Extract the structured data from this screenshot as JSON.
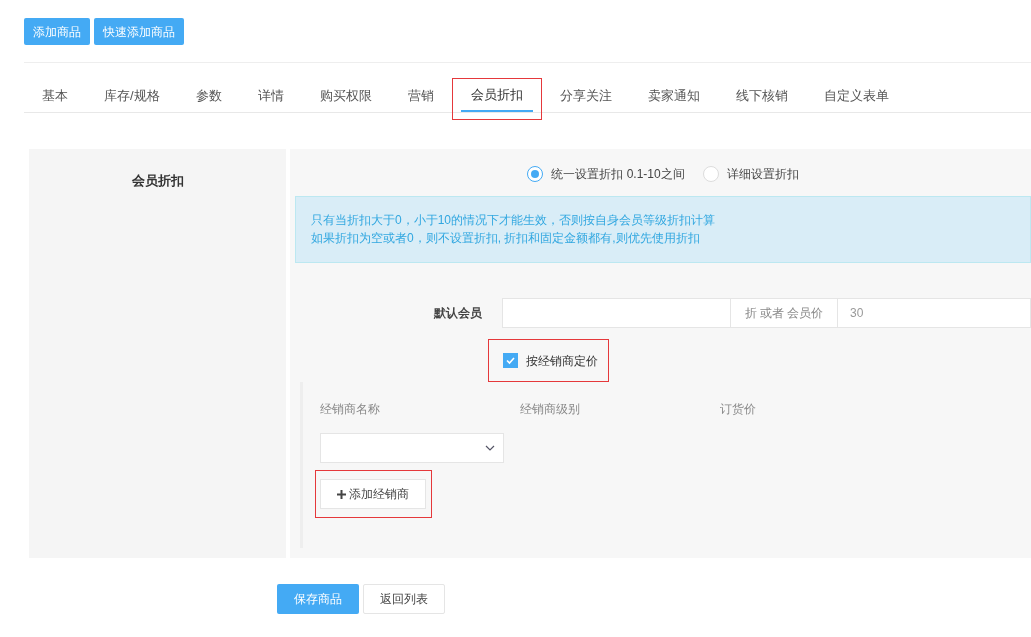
{
  "top_buttons": [
    "添加商品",
    "快速添加商品"
  ],
  "tabs": [
    {
      "label": "基本",
      "selected": false,
      "highlighted": false
    },
    {
      "label": "库存/规格",
      "selected": false,
      "highlighted": false
    },
    {
      "label": "参数",
      "selected": false,
      "highlighted": false
    },
    {
      "label": "详情",
      "selected": false,
      "highlighted": false
    },
    {
      "label": "购买权限",
      "selected": false,
      "highlighted": false
    },
    {
      "label": "营销",
      "selected": false,
      "highlighted": false
    },
    {
      "label": "会员折扣",
      "selected": true,
      "highlighted": true
    },
    {
      "label": "分享关注",
      "selected": false,
      "highlighted": false
    },
    {
      "label": "卖家通知",
      "selected": false,
      "highlighted": false
    },
    {
      "label": "线下核销",
      "selected": false,
      "highlighted": false
    },
    {
      "label": "自定义表单",
      "selected": false,
      "highlighted": false
    }
  ],
  "section_title": "会员折扣",
  "radios": [
    {
      "label": "统一设置折扣 0.1-10之间",
      "selected": true
    },
    {
      "label": "详细设置折扣",
      "selected": false
    }
  ],
  "notice": [
    "只有当折扣大于0，小于10的情况下才能生效，否则按自身会员等级折扣计算",
    "如果折扣为空或者0，则不设置折扣, 折扣和固定金额都有,则优先使用折扣"
  ],
  "member_row": {
    "label": "默认会员",
    "addon": "折 或者 会员价",
    "price_placeholder": "30"
  },
  "dealer_pricing": {
    "label": "按经销商定价",
    "checked": true,
    "highlighted": true
  },
  "dealer_table": {
    "columns": [
      "经销商名称",
      "经销商级别",
      "订货价"
    ]
  },
  "add_dealer": {
    "label": "添加经销商",
    "highlighted": true
  },
  "bottom_buttons": [
    {
      "label": "保存商品",
      "kind": "primary"
    },
    {
      "label": "返回列表",
      "kind": "default"
    }
  ]
}
